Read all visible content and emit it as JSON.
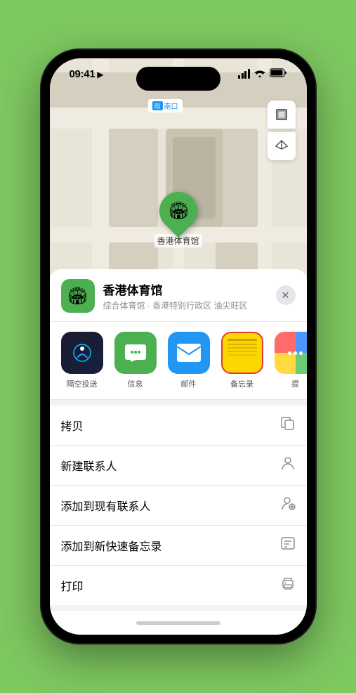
{
  "statusBar": {
    "time": "09:41",
    "timeArrow": "▶"
  },
  "map": {
    "southEntrance": "南口",
    "southEntranceBadge": "出",
    "locationPin": "🏟",
    "venueName": "香港体育馆"
  },
  "mapButtons": {
    "layersIcon": "🗺",
    "locationIcon": "↗"
  },
  "bottomSheet": {
    "venueIcon": "🏟",
    "venueName": "香港体育馆",
    "venueDetail": "综合体育馆 · 香港特别行政区 油尖旺区",
    "closeLabel": "✕",
    "shareItems": [
      {
        "id": "airdrop",
        "label": "隔空投送"
      },
      {
        "id": "messages",
        "label": "信息"
      },
      {
        "id": "mail",
        "label": "邮件"
      },
      {
        "id": "notes",
        "label": "备忘录"
      },
      {
        "id": "more",
        "label": "提"
      }
    ],
    "actions": [
      {
        "label": "拷贝",
        "icon": "⎘"
      },
      {
        "label": "新建联系人",
        "icon": "👤"
      },
      {
        "label": "添加到现有联系人",
        "icon": "👤+"
      },
      {
        "label": "添加到新快速备忘录",
        "icon": "📋"
      },
      {
        "label": "打印",
        "icon": "🖨"
      }
    ]
  }
}
